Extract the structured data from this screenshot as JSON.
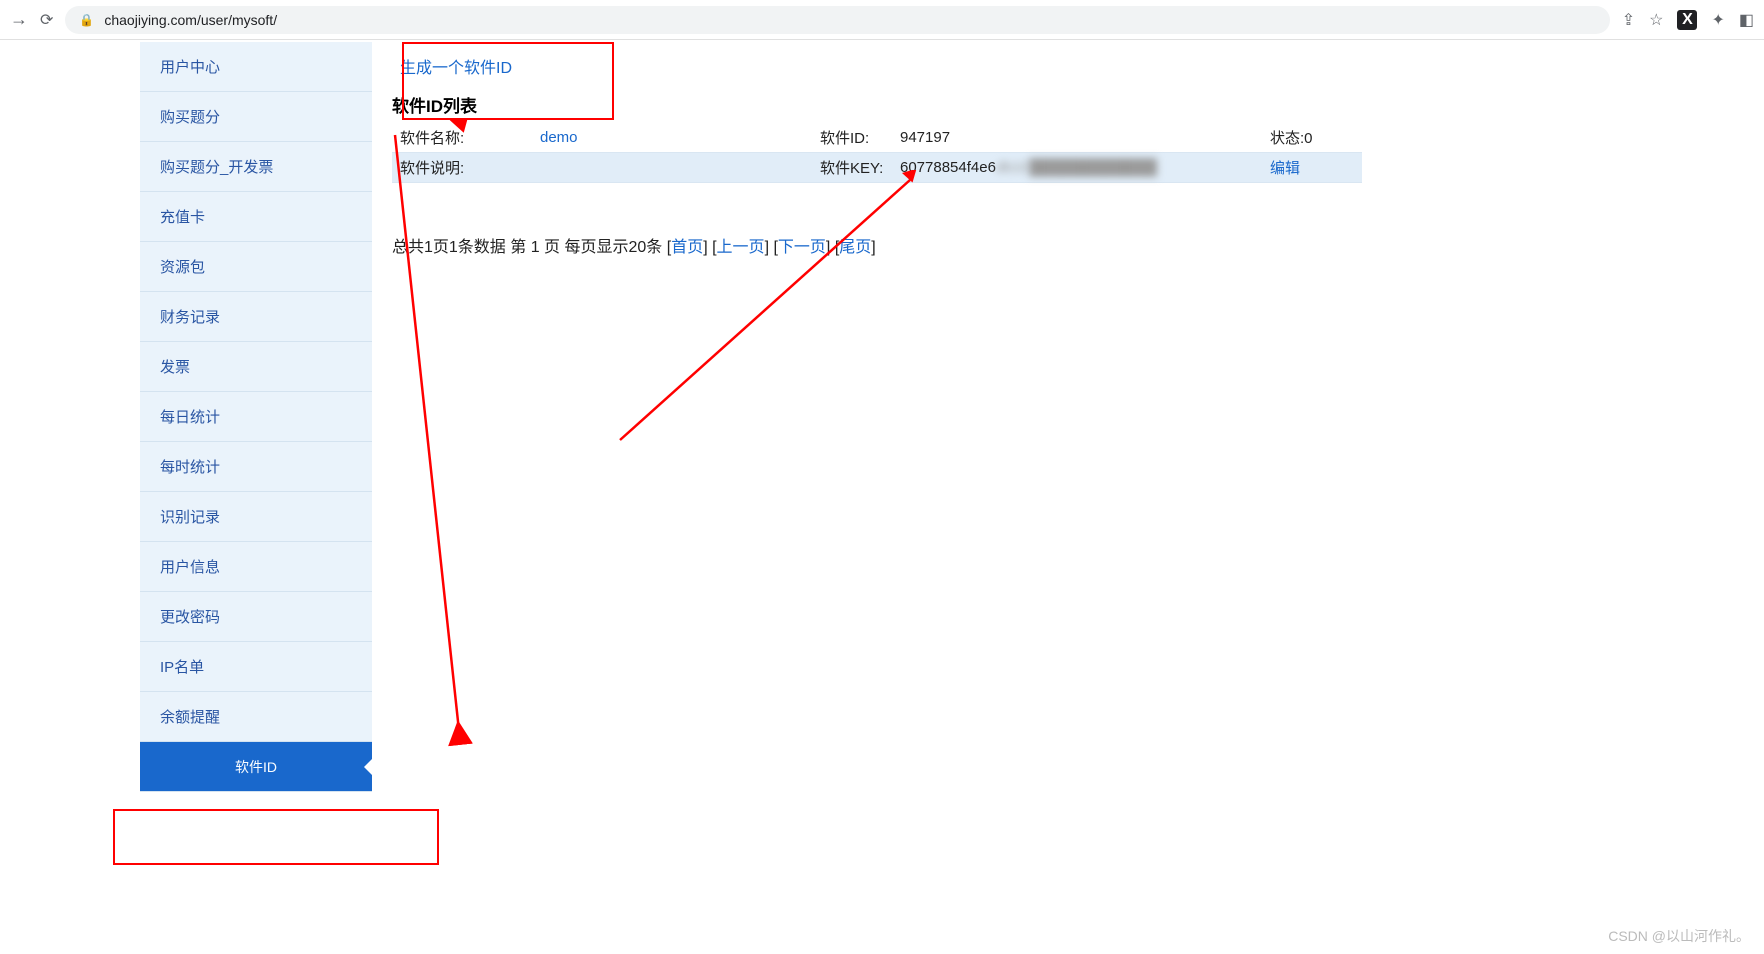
{
  "browser": {
    "url": "chaojiying.com/user/mysoft/"
  },
  "sidebar": {
    "items": [
      {
        "label": "用户中心"
      },
      {
        "label": "购买题分"
      },
      {
        "label": "购买题分_开发票"
      },
      {
        "label": "充值卡"
      },
      {
        "label": "资源包"
      },
      {
        "label": "财务记录"
      },
      {
        "label": "发票"
      },
      {
        "label": "每日统计"
      },
      {
        "label": "每时统计"
      },
      {
        "label": "识别记录"
      },
      {
        "label": "用户信息"
      },
      {
        "label": "更改密码"
      },
      {
        "label": "IP名单"
      },
      {
        "label": "余额提醒"
      },
      {
        "label": "软件ID"
      }
    ]
  },
  "main": {
    "gen_link": "生成一个软件ID",
    "list_title": "软件ID列表",
    "row1": {
      "name_label": "软件名称:",
      "name_value": "demo",
      "id_label": "软件ID:",
      "id_value": "947197",
      "status_label": "状态:0"
    },
    "row2": {
      "desc_label": "软件说明:",
      "desc_value": "",
      "key_label": "软件KEY:",
      "key_value": "60778854f4e6",
      "key_blur": "db10",
      "edit": "编辑"
    },
    "pagination": {
      "prefix": "总共1页1条数据 第 1 页 每页显示20条 ",
      "first": "首页",
      "prev": "上一页",
      "next": "下一页",
      "last": "尾页"
    }
  },
  "watermark": "CSDN @以山河作礼。"
}
